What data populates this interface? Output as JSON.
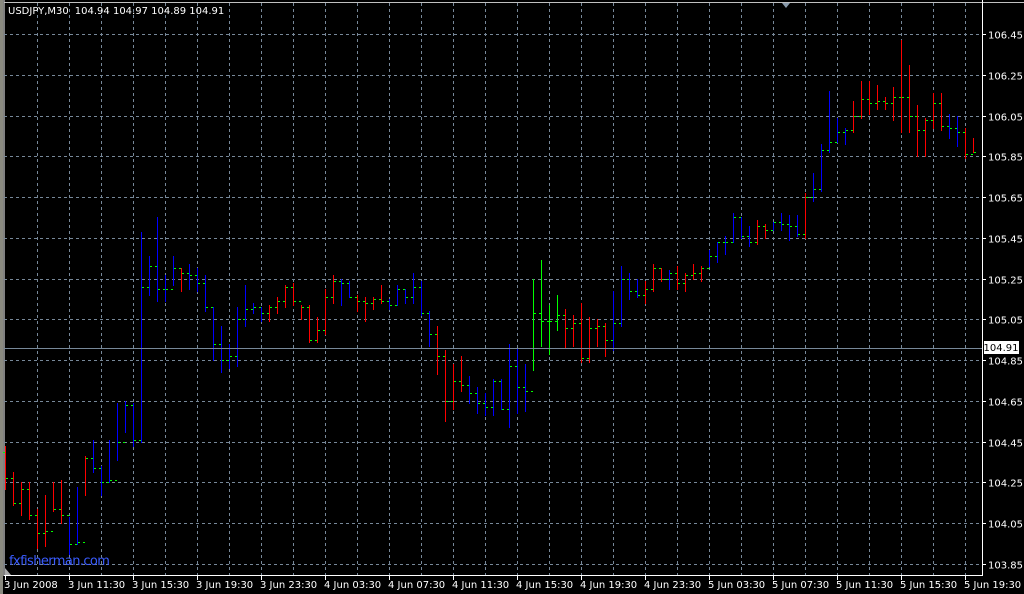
{
  "header": {
    "symbol": "USDJPY,M30",
    "ohlc": "104.94 104.97 104.89 104.91"
  },
  "watermark": "fxfisherman.com",
  "colors": {
    "background": "#000000",
    "grid": "#778899",
    "axis": "#ffffff",
    "bar_red": "#ff0000",
    "bar_blue": "#0000ff",
    "bar_green": "#00ff00",
    "tick": "#00ff00",
    "watermark": "#3a5cff",
    "bid_line": "#778899"
  },
  "chart_data": {
    "type": "ohlc-bar",
    "title": "USDJPY,M30",
    "bar_interval_minutes": 30,
    "ylim": [
      103.8,
      106.5
    ],
    "grid": true,
    "current_price": "104.91",
    "price_ticks": [
      "106.45",
      "106.25",
      "106.05",
      "105.85",
      "105.65",
      "105.45",
      "105.25",
      "105.05",
      "104.85",
      "104.65",
      "104.45",
      "104.25",
      "104.05",
      "103.85"
    ],
    "time_ticks": [
      "3 Jun 2008",
      "3 Jun 11:30",
      "3 Jun 15:30",
      "3 Jun 19:30",
      "3 Jun 23:30",
      "4 Jun 03:30",
      "4 Jun 07:30",
      "4 Jun 11:30",
      "4 Jun 15:30",
      "4 Jun 19:30",
      "4 Jun 23:30",
      "5 Jun 03:30",
      "5 Jun 07:30",
      "5 Jun 11:30",
      "5 Jun 15:30",
      "5 Jun 19:30"
    ],
    "first_open": 104.4,
    "bar_fields": [
      "high",
      "low",
      "close",
      "color"
    ],
    "bars": [
      [
        104.43,
        104.22,
        104.27,
        "r"
      ],
      [
        104.3,
        104.14,
        104.15,
        "r"
      ],
      [
        104.25,
        104.09,
        104.22,
        "r"
      ],
      [
        104.25,
        104.07,
        104.09,
        "r"
      ],
      [
        104.12,
        103.93,
        104.0,
        "r"
      ],
      [
        104.19,
        103.94,
        104.01,
        "r"
      ],
      [
        104.25,
        104.11,
        104.12,
        "r"
      ],
      [
        104.26,
        104.05,
        104.09,
        "r"
      ],
      [
        104.08,
        103.9,
        103.95,
        "b"
      ],
      [
        104.23,
        103.95,
        103.96,
        "b"
      ],
      [
        104.38,
        104.19,
        104.37,
        "r"
      ],
      [
        104.46,
        104.3,
        104.32,
        "b"
      ],
      [
        104.33,
        104.19,
        104.25,
        "b"
      ],
      [
        104.46,
        104.25,
        104.26,
        "b"
      ],
      [
        104.64,
        104.36,
        104.45,
        "b"
      ],
      [
        104.65,
        104.5,
        104.63,
        "b"
      ],
      [
        104.64,
        104.43,
        104.46,
        "b"
      ],
      [
        105.48,
        104.45,
        105.21,
        "b"
      ],
      [
        105.36,
        105.17,
        105.31,
        "b"
      ],
      [
        105.55,
        105.14,
        105.2,
        "b"
      ],
      [
        105.27,
        105.14,
        105.2,
        "b"
      ],
      [
        105.36,
        105.22,
        105.3,
        "b"
      ],
      [
        105.3,
        105.19,
        105.28,
        "r"
      ],
      [
        105.32,
        105.2,
        105.27,
        "b"
      ],
      [
        105.3,
        105.19,
        105.23,
        "b"
      ],
      [
        105.27,
        105.09,
        105.11,
        "b"
      ],
      [
        105.11,
        104.85,
        104.93,
        "b"
      ],
      [
        105.02,
        104.79,
        104.85,
        "b"
      ],
      [
        104.93,
        104.81,
        104.87,
        "b"
      ],
      [
        105.11,
        104.82,
        105.05,
        "b"
      ],
      [
        105.22,
        105.02,
        105.1,
        "b"
      ],
      [
        105.13,
        105.08,
        105.11,
        "b"
      ],
      [
        105.11,
        105.04,
        105.08,
        "b"
      ],
      [
        105.12,
        105.04,
        105.11,
        "r"
      ],
      [
        105.16,
        105.08,
        105.14,
        "r"
      ],
      [
        105.22,
        105.11,
        105.21,
        "r"
      ],
      [
        105.23,
        105.12,
        105.14,
        "r"
      ],
      [
        105.12,
        105.05,
        105.11,
        "r"
      ],
      [
        105.12,
        104.94,
        104.95,
        "r"
      ],
      [
        105.06,
        104.94,
        105.0,
        "r"
      ],
      [
        105.2,
        104.98,
        105.16,
        "r"
      ],
      [
        105.27,
        105.13,
        105.24,
        "r"
      ],
      [
        105.25,
        105.12,
        105.23,
        "b"
      ],
      [
        105.24,
        105.16,
        105.16,
        "b"
      ],
      [
        105.17,
        105.09,
        105.14,
        "r"
      ],
      [
        105.16,
        105.04,
        105.13,
        "r"
      ],
      [
        105.16,
        105.1,
        105.15,
        "r"
      ],
      [
        105.22,
        105.13,
        105.14,
        "r"
      ],
      [
        105.15,
        105.1,
        105.12,
        "b"
      ],
      [
        105.22,
        105.12,
        105.2,
        "b"
      ],
      [
        105.2,
        105.13,
        105.16,
        "b"
      ],
      [
        105.28,
        105.13,
        105.21,
        "b"
      ],
      [
        105.24,
        105.07,
        105.08,
        "b"
      ],
      [
        105.09,
        104.92,
        104.98,
        "b"
      ],
      [
        105.02,
        104.78,
        104.87,
        "r"
      ],
      [
        104.9,
        104.55,
        104.65,
        "r"
      ],
      [
        104.83,
        104.61,
        104.75,
        "r"
      ],
      [
        104.87,
        104.7,
        104.73,
        "r"
      ],
      [
        104.77,
        104.64,
        104.69,
        "b"
      ],
      [
        104.72,
        104.59,
        104.64,
        "b"
      ],
      [
        104.69,
        104.58,
        104.62,
        "b"
      ],
      [
        104.76,
        104.58,
        104.75,
        "b"
      ],
      [
        104.76,
        104.61,
        104.61,
        "b"
      ],
      [
        104.93,
        104.52,
        104.82,
        "b"
      ],
      [
        104.91,
        104.59,
        104.72,
        "b"
      ],
      [
        104.83,
        104.6,
        104.7,
        "b"
      ],
      [
        105.25,
        104.8,
        105.08,
        "g"
      ],
      [
        105.34,
        104.92,
        105.04,
        "g"
      ],
      [
        105.12,
        104.88,
        105.04,
        "g"
      ],
      [
        105.17,
        105.0,
        105.07,
        "g"
      ],
      [
        105.1,
        104.91,
        105.01,
        "r"
      ],
      [
        105.07,
        104.92,
        105.03,
        "r"
      ],
      [
        105.13,
        104.84,
        104.86,
        "r"
      ],
      [
        105.06,
        104.84,
        105.01,
        "r"
      ],
      [
        105.05,
        104.92,
        105.02,
        "r"
      ],
      [
        105.03,
        104.87,
        104.95,
        "r"
      ],
      [
        105.19,
        104.9,
        105.03,
        "b"
      ],
      [
        105.31,
        105.02,
        105.25,
        "b"
      ],
      [
        105.28,
        105.15,
        105.19,
        "b"
      ],
      [
        105.25,
        105.16,
        105.17,
        "b"
      ],
      [
        105.24,
        105.13,
        105.2,
        "r"
      ],
      [
        105.32,
        105.19,
        105.3,
        "r"
      ],
      [
        105.3,
        105.24,
        105.25,
        "r"
      ],
      [
        105.29,
        105.2,
        105.28,
        "b"
      ],
      [
        105.31,
        105.2,
        105.23,
        "r"
      ],
      [
        105.28,
        105.19,
        105.27,
        "r"
      ],
      [
        105.32,
        105.25,
        105.28,
        "r"
      ],
      [
        105.31,
        105.24,
        105.3,
        "r"
      ],
      [
        105.39,
        105.31,
        105.36,
        "b"
      ],
      [
        105.43,
        105.33,
        105.43,
        "b"
      ],
      [
        105.46,
        105.37,
        105.43,
        "b"
      ],
      [
        105.57,
        105.43,
        105.55,
        "b"
      ],
      [
        105.55,
        105.45,
        105.46,
        "b"
      ],
      [
        105.51,
        105.41,
        105.43,
        "b"
      ],
      [
        105.54,
        105.42,
        105.51,
        "r"
      ],
      [
        105.52,
        105.45,
        105.49,
        "r"
      ],
      [
        105.53,
        105.49,
        105.53,
        "b"
      ],
      [
        105.57,
        105.49,
        105.52,
        "b"
      ],
      [
        105.56,
        105.44,
        105.51,
        "b"
      ],
      [
        105.56,
        105.46,
        105.47,
        "b"
      ],
      [
        105.67,
        105.45,
        105.65,
        "r"
      ],
      [
        105.77,
        105.63,
        105.69,
        "b"
      ],
      [
        105.91,
        105.68,
        105.88,
        "b"
      ],
      [
        106.17,
        105.87,
        105.92,
        "b"
      ],
      [
        106.04,
        105.92,
        105.97,
        "b"
      ],
      [
        105.99,
        105.91,
        105.98,
        "b"
      ],
      [
        106.12,
        105.97,
        106.05,
        "r"
      ],
      [
        106.22,
        106.04,
        106.13,
        "r"
      ],
      [
        106.22,
        106.06,
        106.11,
        "r"
      ],
      [
        106.2,
        106.08,
        106.12,
        "r"
      ],
      [
        106.14,
        106.08,
        106.11,
        "r"
      ],
      [
        106.19,
        106.03,
        106.14,
        "r"
      ],
      [
        106.42,
        105.97,
        106.14,
        "r"
      ],
      [
        106.3,
        105.97,
        106.05,
        "r"
      ],
      [
        106.1,
        105.85,
        105.98,
        "r"
      ],
      [
        106.04,
        105.85,
        106.03,
        "r"
      ],
      [
        106.16,
        105.99,
        106.11,
        "r"
      ],
      [
        106.16,
        105.98,
        106.0,
        "r"
      ],
      [
        106.06,
        105.94,
        105.99,
        "b"
      ],
      [
        106.05,
        105.9,
        105.97,
        "b"
      ],
      [
        105.99,
        105.84,
        105.86,
        "r"
      ],
      [
        105.94,
        105.87,
        105.87,
        "r"
      ]
    ]
  }
}
